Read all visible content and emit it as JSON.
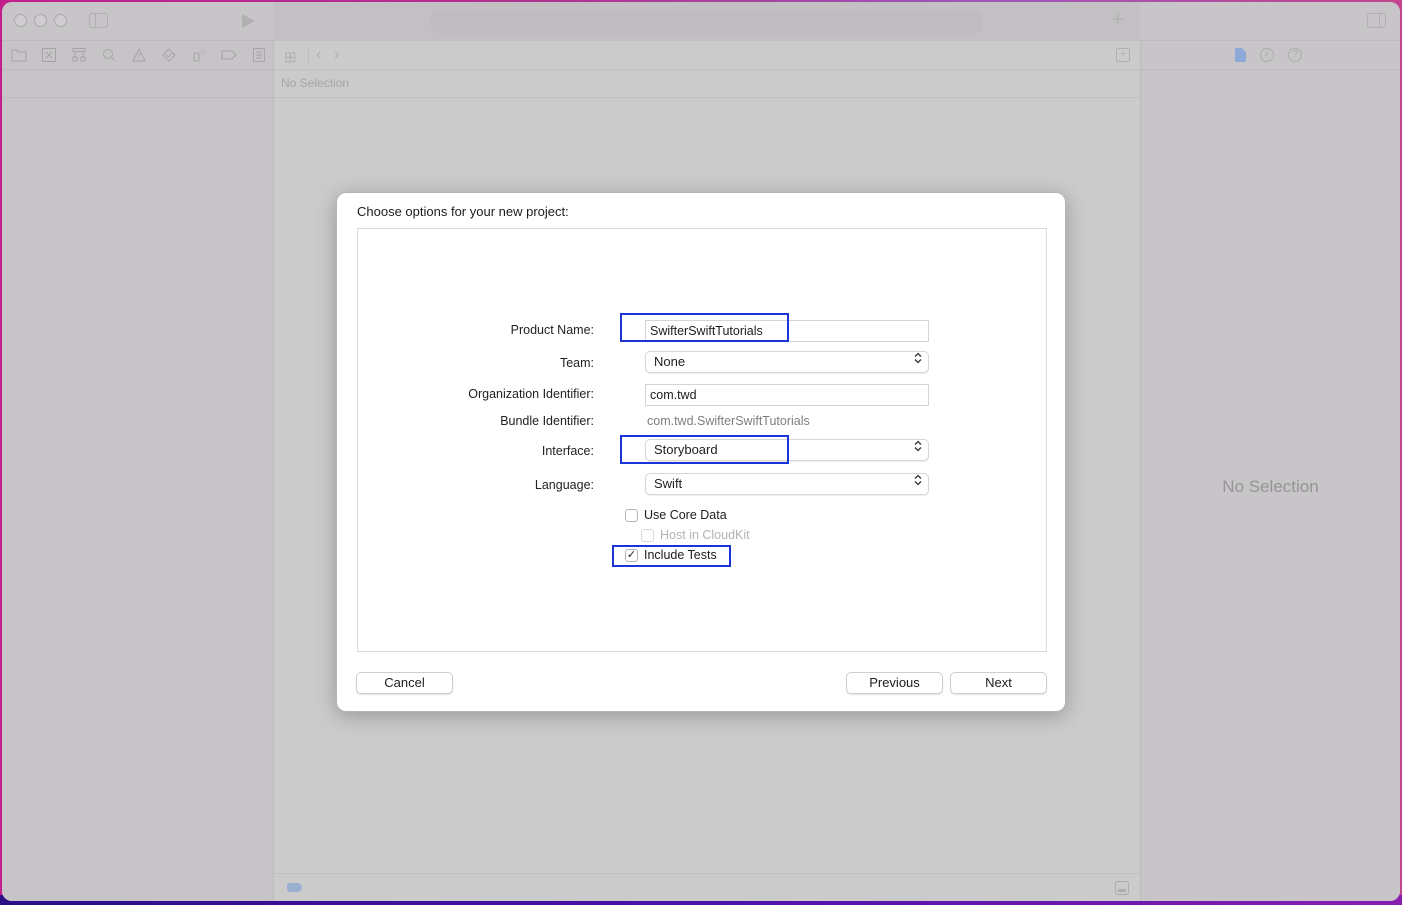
{
  "window": {
    "traffic_lights": [
      "close",
      "minimize",
      "zoom"
    ],
    "activity_text": ""
  },
  "navigator": {
    "icons": [
      "folder-icon",
      "source-control-icon",
      "hierarchy-icon",
      "search-icon",
      "warning-icon",
      "test-diamond-icon",
      "debug-spray-icon",
      "breakpoint-tag-icon",
      "report-list-icon"
    ]
  },
  "editor": {
    "path_bar_text": "No Selection"
  },
  "inspector": {
    "no_selection": "No Selection"
  },
  "dialog": {
    "title": "Choose options for your new project:",
    "product_name": {
      "label": "Product Name:",
      "value": "SwifterSwiftTutorials"
    },
    "team": {
      "label": "Team:",
      "value": "None"
    },
    "org_identifier": {
      "label": "Organization Identifier:",
      "value": "com.twd"
    },
    "bundle_identifier": {
      "label": "Bundle Identifier:",
      "value": "com.twd.SwifterSwiftTutorials"
    },
    "interface": {
      "label": "Interface:",
      "value": "Storyboard"
    },
    "language": {
      "label": "Language:",
      "value": "Swift"
    },
    "use_core_data": {
      "label": "Use Core Data",
      "checked": false
    },
    "host_in_cloudkit": {
      "label": "Host in CloudKit",
      "checked": false,
      "disabled": true
    },
    "include_tests": {
      "label": "Include Tests",
      "checked": true
    },
    "buttons": {
      "cancel": "Cancel",
      "previous": "Previous",
      "next": "Next"
    }
  },
  "icons": {
    "popup_chevron": "⌃⌄",
    "checkmark": "✓",
    "plus": "+",
    "grid": "⊞",
    "back": "‹",
    "forward": "›"
  },
  "colors": {
    "highlight": "#1a35d6",
    "file_icon_accent": "#8ea9d8"
  }
}
